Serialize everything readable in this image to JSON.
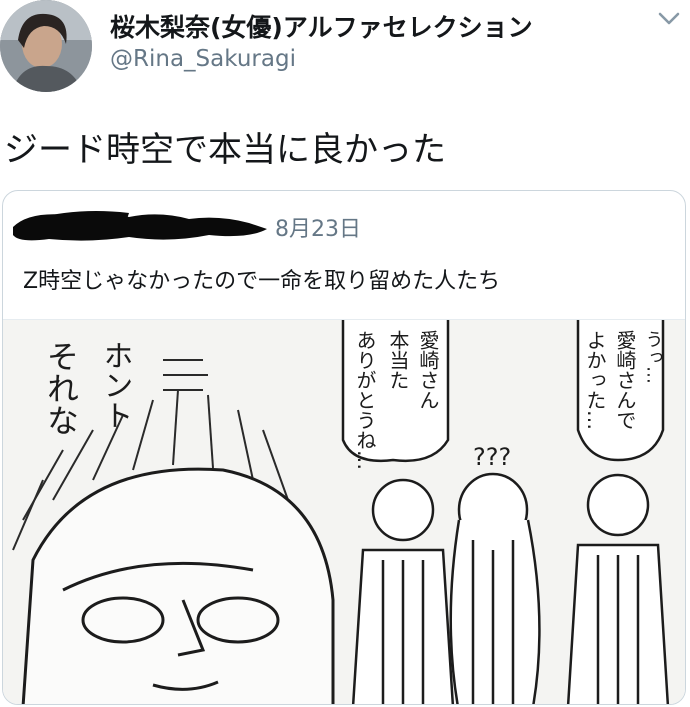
{
  "header": {
    "display_name": "桜木梨奈(女優)アルファセレクション",
    "handle": "@Rina_Sakuragi",
    "menu_icon": "chevron-down-icon"
  },
  "tweet": {
    "text": "ジード時空で本当に良かった"
  },
  "quoted_tweet": {
    "date": "8月23日",
    "text": "Z時空じゃなかったので一命を取り留めた人たち",
    "image": {
      "bubble_left_1": "ホント",
      "bubble_left_2": "それな",
      "bubble_mid_1": "愛崎さん",
      "bubble_mid_2": "本当た",
      "bubble_mid_3": "ありがとうね…",
      "bubble_right_1": "うっ…",
      "bubble_right_2": "愛崎さんで",
      "bubble_right_3": "よかった…",
      "question_marks": "???"
    }
  },
  "colors": {
    "handle_gray": "#657786",
    "border": "#ccd6dd",
    "text": "#14171a"
  }
}
